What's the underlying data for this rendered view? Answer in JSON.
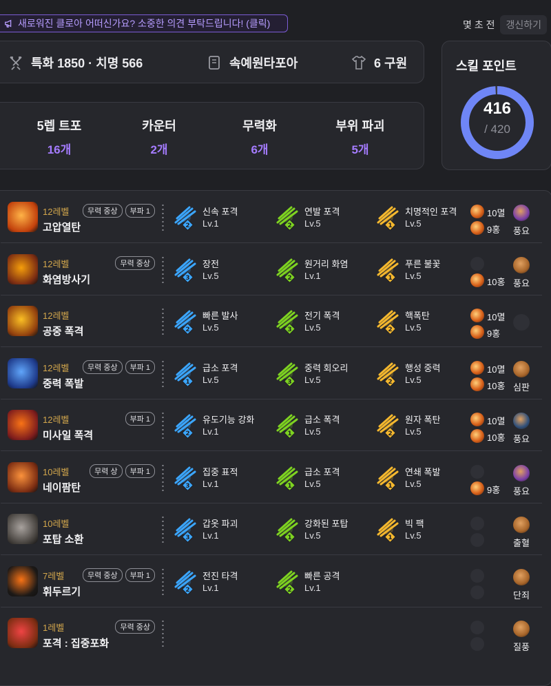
{
  "banner": {
    "text": "새로워진 클로아 어떠신가요? 소중한 의견 부탁드립니다! (클릭)"
  },
  "header": {
    "time_ago": "몇 초 전",
    "refresh_label": "갱신하기"
  },
  "stats": {
    "spec": "특화 1850 · 치명 566",
    "engraving": "속예원타포아",
    "gear": "6 구원"
  },
  "counts": [
    {
      "label": "5렙 트포",
      "value": "16개"
    },
    {
      "label": "카운터",
      "value": "2개"
    },
    {
      "label": "무력화",
      "value": "6개"
    },
    {
      "label": "부위 파괴",
      "value": "5개"
    }
  ],
  "skill_points": {
    "title": "스킬 포인트",
    "current": "416",
    "max": "/ 420",
    "fill_fraction": 0.99
  },
  "skills": [
    {
      "level": "12레벨",
      "name": "고압열탄",
      "tags": [
        "무력 중상",
        "부파 1"
      ],
      "tripods": [
        {
          "name": "신속 포격",
          "lv": "Lv.1",
          "tier": "2",
          "color": "blue"
        },
        {
          "name": "연발 포격",
          "lv": "Lv.5",
          "tier": "2",
          "color": "green"
        },
        {
          "name": "치명적인 포격",
          "lv": "Lv.5",
          "tier": "1",
          "color": "gold"
        }
      ],
      "gems": [
        "10멸",
        "9홍"
      ],
      "rune": "풍요",
      "rune_color": "#7a3fa8"
    },
    {
      "level": "12레벨",
      "name": "화염방사기",
      "tags": [
        "무력 중상"
      ],
      "tripods": [
        {
          "name": "장전",
          "lv": "Lv.5",
          "tier": "3",
          "color": "blue"
        },
        {
          "name": "원거리 화염",
          "lv": "Lv.1",
          "tier": "2",
          "color": "green"
        },
        {
          "name": "푸른 불꽃",
          "lv": "Lv.5",
          "tier": "1",
          "color": "gold"
        }
      ],
      "gems": [
        "",
        "10홍"
      ],
      "rune": "풍요",
      "rune_color": "#a7652a"
    },
    {
      "level": "12레벨",
      "name": "공중 폭격",
      "tags": [],
      "tripods": [
        {
          "name": "빠른 발사",
          "lv": "Lv.5",
          "tier": "2",
          "color": "blue"
        },
        {
          "name": "전기 폭격",
          "lv": "Lv.5",
          "tier": "3",
          "color": "green"
        },
        {
          "name": "핵폭탄",
          "lv": "Lv.5",
          "tier": "2",
          "color": "gold"
        }
      ],
      "gems": [
        "10멸",
        "9홍"
      ],
      "rune": "",
      "rune_color": "#2f3036"
    },
    {
      "level": "12레벨",
      "name": "중력 폭발",
      "tags": [
        "무력 중상",
        "부파 1"
      ],
      "tripods": [
        {
          "name": "급소 포격",
          "lv": "Lv.5",
          "tier": "1",
          "color": "blue"
        },
        {
          "name": "중력 회오리",
          "lv": "Lv.5",
          "tier": "3",
          "color": "green"
        },
        {
          "name": "행성 중력",
          "lv": "Lv.5",
          "tier": "2",
          "color": "gold"
        }
      ],
      "gems": [
        "10멸",
        "10홍"
      ],
      "rune": "심판",
      "rune_color": "#a7652a"
    },
    {
      "level": "12레벨",
      "name": "미사일 폭격",
      "tags": [
        "부파 1"
      ],
      "tripods": [
        {
          "name": "유도기능 강화",
          "lv": "Lv.1",
          "tier": "2",
          "color": "blue"
        },
        {
          "name": "급소 폭격",
          "lv": "Lv.5",
          "tier": "1",
          "color": "green"
        },
        {
          "name": "원자 폭탄",
          "lv": "Lv.5",
          "tier": "2",
          "color": "gold"
        }
      ],
      "gems": [
        "10멸",
        "10홍"
      ],
      "rune": "풍요",
      "rune_color": "#2e4f7a"
    },
    {
      "level": "10레벨",
      "name": "네이팜탄",
      "tags": [
        "무력 상",
        "부파 1"
      ],
      "tripods": [
        {
          "name": "집중 표적",
          "lv": "Lv.1",
          "tier": "3",
          "color": "blue"
        },
        {
          "name": "급소 포격",
          "lv": "Lv.5",
          "tier": "1",
          "color": "green"
        },
        {
          "name": "연쇄 폭발",
          "lv": "Lv.5",
          "tier": "1",
          "color": "gold"
        }
      ],
      "gems": [
        "",
        "9홍"
      ],
      "rune": "풍요",
      "rune_color": "#7a3fa8"
    },
    {
      "level": "10레벨",
      "name": "포탑 소환",
      "tags": [],
      "tripods": [
        {
          "name": "갑옷 파괴",
          "lv": "Lv.1",
          "tier": "3",
          "color": "blue"
        },
        {
          "name": "강화된 포탑",
          "lv": "Lv.5",
          "tier": "1",
          "color": "green"
        },
        {
          "name": "빅 팩",
          "lv": "Lv.5",
          "tier": "1",
          "color": "gold"
        }
      ],
      "gems": [
        "",
        ""
      ],
      "rune": "출혈",
      "rune_color": "#a7652a"
    },
    {
      "level": "7레벨",
      "name": "휘두르기",
      "tags": [
        "무력 중상",
        "부파 1"
      ],
      "tripods": [
        {
          "name": "전진 타격",
          "lv": "Lv.1",
          "tier": "2",
          "color": "blue"
        },
        {
          "name": "빠른 공격",
          "lv": "Lv.1",
          "tier": "2",
          "color": "green"
        }
      ],
      "gems": [
        "",
        ""
      ],
      "rune": "단죄",
      "rune_color": "#a7652a"
    },
    {
      "level": "1레벨",
      "name": "포격 : 집중포화",
      "tags": [
        "무력 중상"
      ],
      "tripods": [],
      "gems": [
        "",
        ""
      ],
      "rune": "질풍",
      "rune_color": "#a7652a"
    }
  ],
  "colors": {
    "accent": "#a57cff",
    "level": "#d2a64c",
    "ring": "#6f86f6"
  }
}
